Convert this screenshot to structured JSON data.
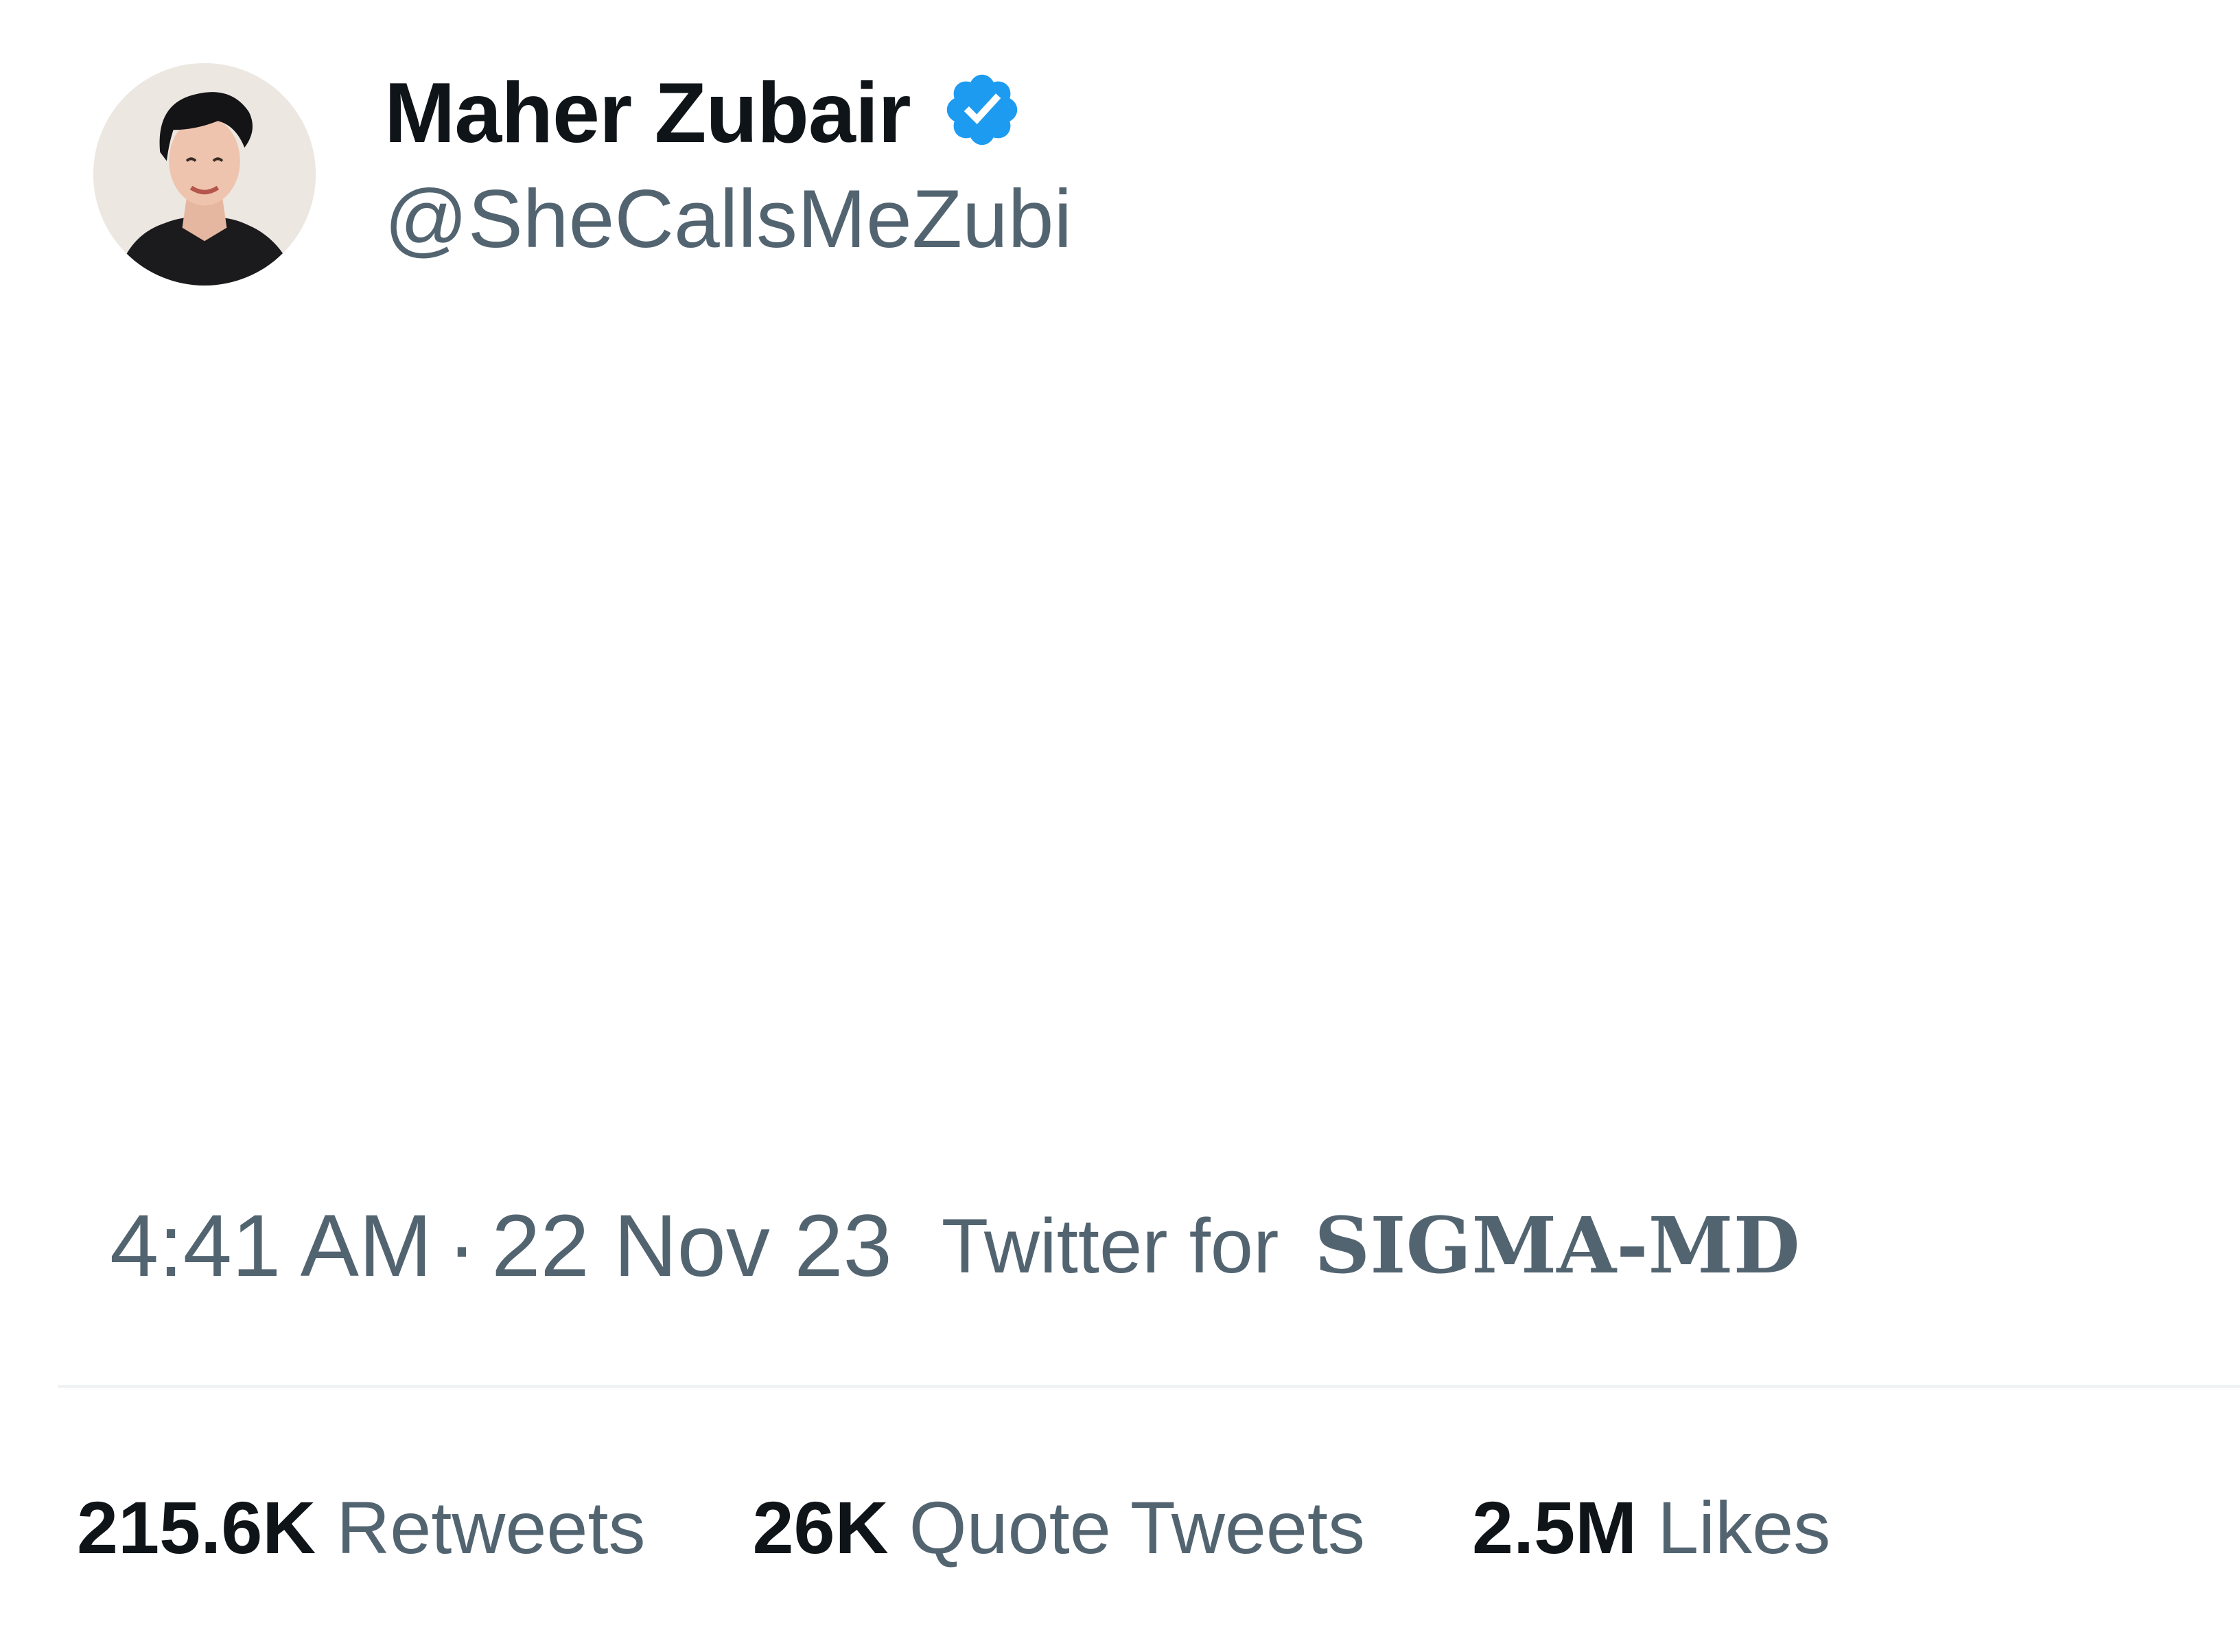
{
  "author": {
    "display_name": "Maher Zubair",
    "handle": "@SheCallsMeZubi",
    "verified_icon": "verified-badge-icon",
    "verified_color": "#1d9bf0"
  },
  "meta": {
    "time": "4:41 AM",
    "separator": "·",
    "date": "22 Nov 23",
    "via": "Twitter for",
    "client": "SIGMA-MD"
  },
  "stats": [
    {
      "count": "215.6K",
      "label": "Retweets"
    },
    {
      "count": "26K",
      "label": "Quote Tweets"
    },
    {
      "count": "2.5M",
      "label": "Likes"
    }
  ],
  "colors": {
    "primary_text": "#0f1419",
    "secondary_text": "#536471",
    "divider": "#eff3f4"
  }
}
